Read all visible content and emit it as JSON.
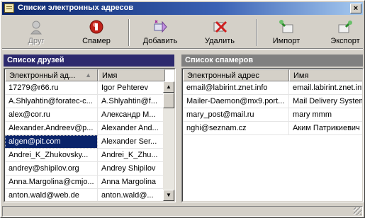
{
  "window": {
    "title": "Списки электронных адресов",
    "close_glyph": "×"
  },
  "toolbar": {
    "buttons": [
      {
        "label": "Друг",
        "icon": "friend-icon",
        "disabled": true
      },
      {
        "label": "Спамер",
        "icon": "spammer-icon",
        "disabled": false
      },
      {
        "label": "Добавить",
        "icon": "add-icon",
        "disabled": false
      },
      {
        "label": "Удалить",
        "icon": "delete-icon",
        "disabled": false
      },
      {
        "label": "Импорт",
        "icon": "import-icon",
        "disabled": false
      },
      {
        "label": "Экспорт",
        "icon": "export-icon",
        "disabled": false
      }
    ]
  },
  "friends": {
    "title": "Список друзей",
    "header_color": "#2d2a6e",
    "columns": [
      "Электронный ад...",
      "Имя"
    ],
    "rows": [
      [
        "17279@r66.ru",
        "Igor Pehterev"
      ],
      [
        "A.Shlyahtin@foratec-c...",
        "A.Shlyahtin@f..."
      ],
      [
        "alex@cor.ru",
        "Александр М..."
      ],
      [
        "Alexander.Andreev@p...",
        "Alexander And..."
      ],
      [
        "algen@pit.com",
        "Alexander Ser..."
      ],
      [
        "Andrei_K_Zhukovsky...",
        "Andrei_K_Zhu..."
      ],
      [
        "andrey@shipilov.org",
        "Andrey Shipilov"
      ],
      [
        "Anna.Margolina@cmjo...",
        "Anna Margolina"
      ],
      [
        "anton.wald@web.de",
        "anton.wald@..."
      ]
    ],
    "selected_index": 4
  },
  "spammers": {
    "title": "Список спамеров",
    "header_color": "#808080",
    "columns": [
      "Электронный адрес",
      "Имя"
    ],
    "rows": [
      [
        "email@labirint.znet.info",
        "email.labirint.znet.info"
      ],
      [
        "Mailer-Daemon@mx9.port...",
        "Mail Delivery System"
      ],
      [
        "mary_post@mail.ru",
        "mary mmm"
      ],
      [
        "nghi@seznam.cz",
        "Аким Патрикиевич"
      ]
    ]
  },
  "scrollbar": {
    "up_glyph": "▲",
    "down_glyph": "▼",
    "sort_glyph": "▲"
  }
}
